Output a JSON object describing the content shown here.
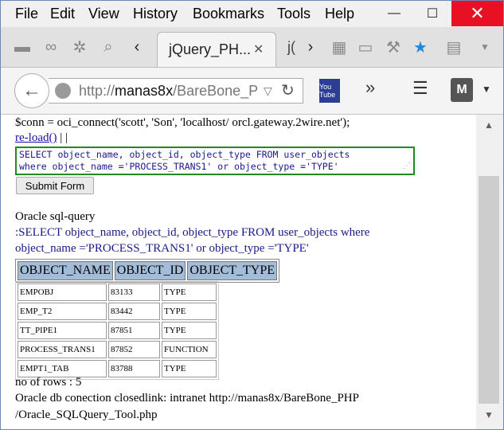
{
  "menu": [
    "File",
    "Edit",
    "View",
    "History",
    "Bookmarks",
    "Tools",
    "Help"
  ],
  "window_controls": {
    "minimize": "—",
    "maximize": "☐",
    "close": "✕"
  },
  "tab": {
    "title": "jQuery_PH...",
    "close": "✕",
    "next_partial": "j("
  },
  "toolbar_icons": [
    "folder-icon",
    "mask-icon",
    "gear-icon",
    "search-icon",
    "chevron-left-icon",
    "chevron-right-icon",
    "grid-icon",
    "window-icon",
    "wrench-icon",
    "star-icon",
    "clipboard-icon",
    "dropdown-icon"
  ],
  "nav": {
    "url_prefix": "http://",
    "url_host": "manas8x",
    "url_path": "/BareBone_P",
    "youtube_label": "You Tube",
    "shield_label": "M"
  },
  "content": {
    "conn_line": "$conn = oci_connect('scott', 'Son', 'localhost/ orcl.gateway.2wire.net');",
    "reload_link": "re-load()",
    "reload_sep": " | |",
    "query_line1": "SELECT object_name, object_id, object_type FROM user_objects",
    "query_line2": "where object_name ='PROCESS_TRANS1' or object_type ='TYPE'",
    "submit_label": "Submit Form",
    "oracle_heading": "Oracle sql-query",
    "query_echo_1": ":SELECT object_name, object_id, object_type FROM user_objects where",
    "query_echo_2": "object_name ='PROCESS_TRANS1' or object_type ='TYPE'",
    "columns": [
      "OBJECT_NAME",
      "OBJECT_ID",
      "OBJECT_TYPE"
    ],
    "rows": [
      [
        "EMPOBJ",
        "83133",
        "TYPE"
      ],
      [
        "EMP_T2",
        "83442",
        "TYPE"
      ],
      [
        "TT_PIPE1",
        "87851",
        "TYPE"
      ],
      [
        "PROCESS_TRANS1",
        "87852",
        "FUNCTION"
      ],
      [
        "EMPT1_TAB",
        "83788",
        "TYPE"
      ]
    ],
    "row_count": "no of rows : 5",
    "closed_line_1": "Oracle db conection closedlink: intranet http://manas8x/BareBone_PHP",
    "closed_line_2": "/Oracle_SQLQuery_Tool.php"
  },
  "colors": {
    "close_button": "#e81123",
    "header_cell": "#a3bcd8",
    "textarea_border": "#1f8b1f",
    "link": "#1a0dab"
  }
}
